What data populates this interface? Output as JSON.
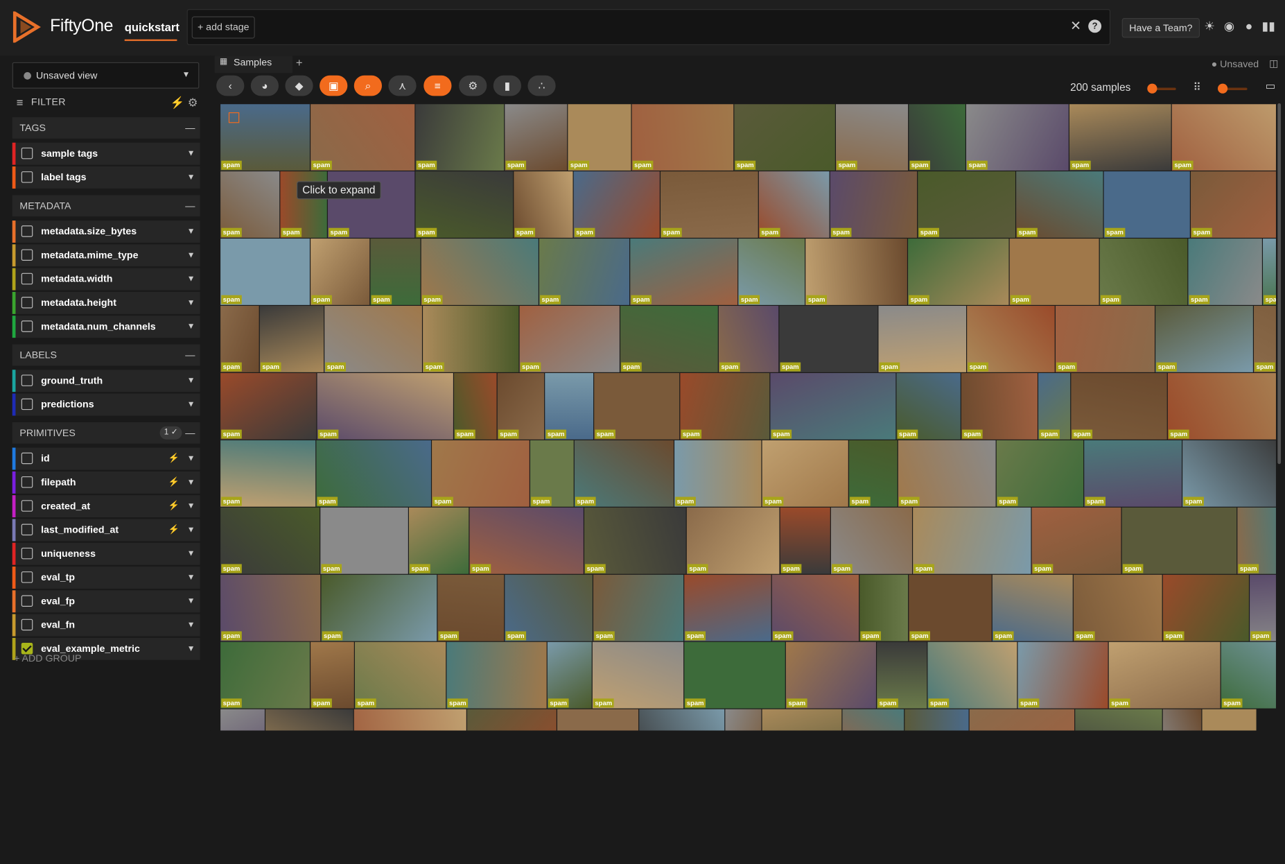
{
  "app": {
    "brand": "FiftyOne",
    "dataset": "quickstart",
    "add_stage": "+ add stage",
    "have_team": "Have a Team?"
  },
  "sidebar": {
    "view_select": "Unsaved view",
    "filter_label": "FILTER",
    "add_group": "+ ADD GROUP",
    "groups": [
      {
        "label": "TAGS",
        "fields": [
          {
            "label": "sample tags",
            "color": "#e02424"
          },
          {
            "label": "label tags",
            "color": "#f05a17"
          }
        ]
      },
      {
        "label": "METADATA",
        "fields": [
          {
            "label": "metadata.size_bytes",
            "color": "#e8702a"
          },
          {
            "label": "metadata.mime_type",
            "color": "#c89b2e"
          },
          {
            "label": "metadata.width",
            "color": "#b0a41a"
          },
          {
            "label": "metadata.height",
            "color": "#3aa52e"
          },
          {
            "label": "metadata.num_channels",
            "color": "#1fa83f"
          }
        ]
      },
      {
        "label": "LABELS",
        "fields": [
          {
            "label": "ground_truth",
            "color": "#1aa6a0"
          },
          {
            "label": "predictions",
            "color": "#1e2bb5"
          }
        ]
      },
      {
        "label": "PRIMITIVES",
        "badge": "1 ✓",
        "fields": [
          {
            "label": "id",
            "color": "#1f7ae0"
          },
          {
            "label": "filepath",
            "color": "#7a1fe0"
          },
          {
            "label": "created_at",
            "color": "#c41fc4"
          },
          {
            "label": "last_modified_at",
            "color": "#7a7ab5"
          },
          {
            "label": "uniqueness",
            "color": "#e02424"
          },
          {
            "label": "eval_tp",
            "color": "#f05a17"
          },
          {
            "label": "eval_fp",
            "color": "#e8702a"
          },
          {
            "label": "eval_fn",
            "color": "#c89b2e"
          },
          {
            "label": "eval_example_metric",
            "color": "#b0a41a"
          }
        ]
      }
    ]
  },
  "main": {
    "tab_label": "Samples",
    "unsaved_label": "Unsaved",
    "sample_count": "200 samples",
    "tooltip": "Click to expand",
    "tile_label": "spam"
  }
}
